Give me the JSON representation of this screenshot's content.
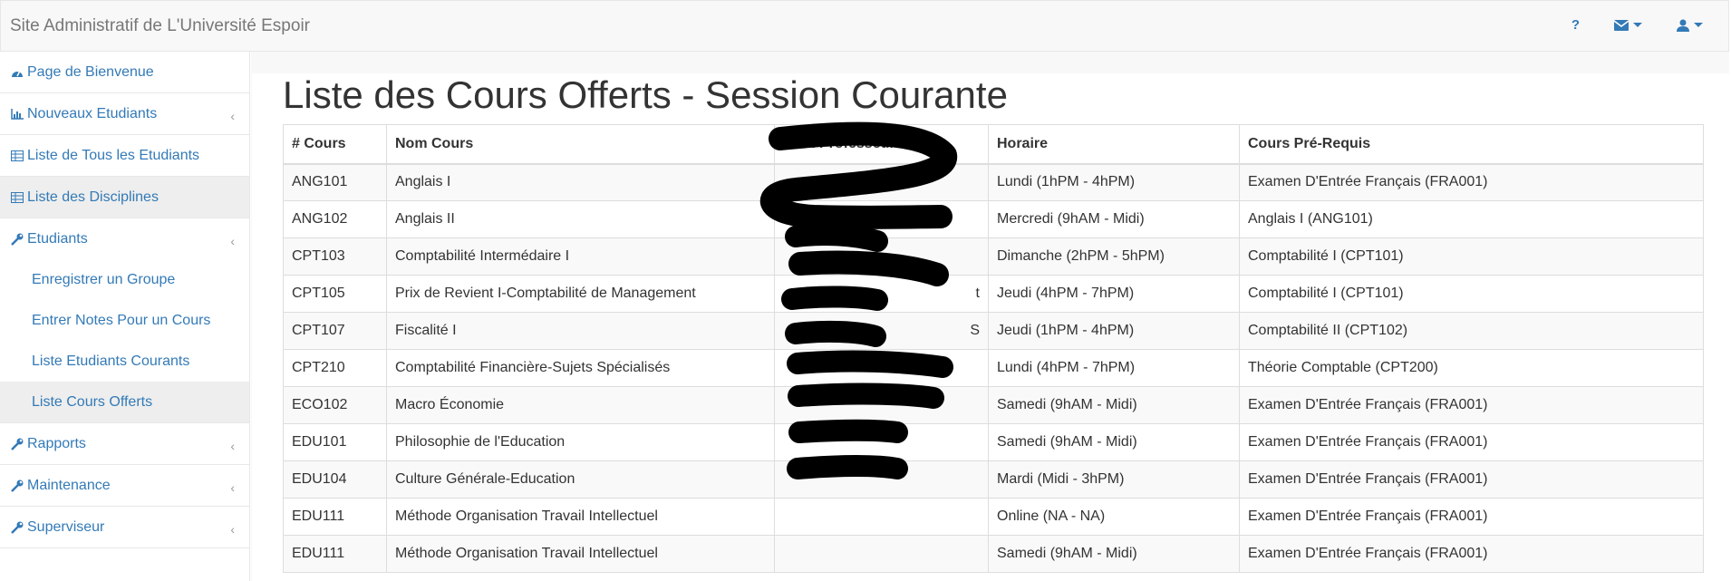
{
  "header": {
    "title": "Site Administratif de L'Université Espoir",
    "help_label": "?"
  },
  "sidebar": {
    "items": [
      {
        "label": "Page de Bienvenue",
        "icon": "dashboard-icon"
      },
      {
        "label": "Nouveaux Etudiants",
        "icon": "bar-chart-icon",
        "chevron": "‹"
      },
      {
        "label": "Liste de Tous les Etudiants",
        "icon": "table-icon"
      },
      {
        "label": "Liste des Disciplines",
        "icon": "table-icon"
      },
      {
        "label": "Etudiants",
        "icon": "wrench-icon",
        "chevron": "‹"
      },
      {
        "label": "Rapports",
        "icon": "wrench-icon",
        "chevron": "‹"
      },
      {
        "label": "Maintenance",
        "icon": "wrench-icon",
        "chevron": "‹"
      },
      {
        "label": "Superviseur",
        "icon": "wrench-icon",
        "chevron": "‹"
      }
    ],
    "sub_items": [
      {
        "label": "Enregistrer un Groupe"
      },
      {
        "label": "Entrer Notes Pour un Cours"
      },
      {
        "label": "Liste Etudiants Courants"
      },
      {
        "label": "Liste Cours Offerts"
      }
    ]
  },
  "main": {
    "title": "Liste des Cours Offerts - Session Courante",
    "columns": [
      "# Cours",
      "Nom Cours",
      "Nom Professeur",
      "Horaire",
      "Cours Pré-Requis"
    ],
    "rows": [
      {
        "code": "ANG101",
        "name": "Anglais I",
        "prof": "",
        "schedule": "Lundi (1hPM - 4hPM)",
        "prereq": "Examen D'Entrée Français (FRA001)"
      },
      {
        "code": "ANG102",
        "name": "Anglais II",
        "prof": "",
        "schedule": "Mercredi (9hAM - Midi)",
        "prereq": "Anglais I (ANG101)"
      },
      {
        "code": "CPT103",
        "name": "Comptabilité Intermédaire I",
        "prof": "",
        "schedule": "Dimanche (2hPM - 5hPM)",
        "prereq": "Comptabilité I (CPT101)"
      },
      {
        "code": "CPT105",
        "name": "Prix de Revient I-Comptabilité de Management",
        "prof": "t",
        "schedule": "Jeudi (4hPM - 7hPM)",
        "prereq": "Comptabilité I (CPT101)"
      },
      {
        "code": "CPT107",
        "name": "Fiscalité I",
        "prof": "S",
        "schedule": "Jeudi (1hPM - 4hPM)",
        "prereq": "Comptabilité II (CPT102)"
      },
      {
        "code": "CPT210",
        "name": "Comptabilité Financière-Sujets Spécialisés",
        "prof": "",
        "schedule": "Lundi (4hPM - 7hPM)",
        "prereq": "Théorie Comptable (CPT200)"
      },
      {
        "code": "ECO102",
        "name": "Macro Économie",
        "prof": "",
        "schedule": "Samedi (9hAM - Midi)",
        "prereq": "Examen D'Entrée Français (FRA001)"
      },
      {
        "code": "EDU101",
        "name": "Philosophie de l'Education",
        "prof": "",
        "schedule": "Samedi (9hAM - Midi)",
        "prereq": "Examen D'Entrée Français (FRA001)"
      },
      {
        "code": "EDU104",
        "name": "Culture Générale-Education",
        "prof": "",
        "schedule": "Mardi (Midi - 3hPM)",
        "prereq": "Examen D'Entrée Français (FRA001)"
      },
      {
        "code": "EDU111",
        "name": "Méthode Organisation Travail Intellectuel",
        "prof": "",
        "schedule": "Online (NA - NA)",
        "prereq": "Examen D'Entrée Français (FRA001)"
      },
      {
        "code": "EDU111",
        "name": "Méthode Organisation Travail Intellectuel",
        "prof": "",
        "schedule": "Samedi (9hAM - Midi)",
        "prereq": "Examen D'Entrée Français (FRA001)"
      }
    ]
  },
  "colors": {
    "link": "#337ab7",
    "brand_text": "#777777",
    "redaction": "#000000"
  }
}
